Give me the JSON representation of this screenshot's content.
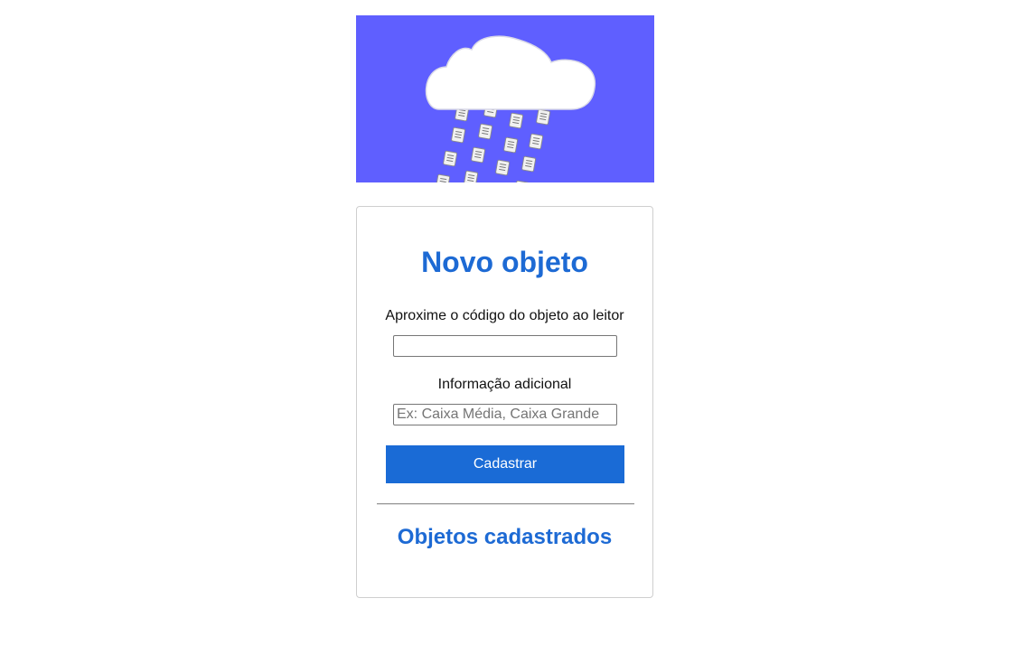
{
  "banner": {
    "background_color": "#5f5fff",
    "image": "cloud-raining-documents"
  },
  "form": {
    "title": "Novo objeto",
    "code_label": "Aproxime o código do objeto ao leitor",
    "code_value": "",
    "info_label": "Informação adicional",
    "info_placeholder": "Ex: Caixa Média, Caixa Grande",
    "info_value": "",
    "submit_label": "Cadastrar"
  },
  "registered": {
    "heading": "Objetos cadastrados"
  },
  "colors": {
    "accent": "#1a6bd6",
    "heading": "#1d6ad4"
  }
}
